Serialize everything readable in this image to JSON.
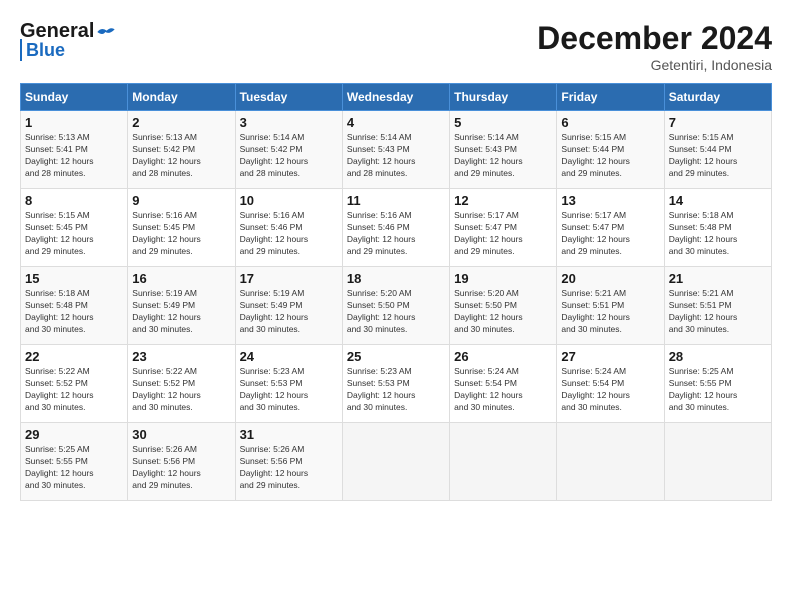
{
  "header": {
    "logo_general": "General",
    "logo_blue": "Blue",
    "month_title": "December 2024",
    "subtitle": "Getentiri, Indonesia"
  },
  "days_of_week": [
    "Sunday",
    "Monday",
    "Tuesday",
    "Wednesday",
    "Thursday",
    "Friday",
    "Saturday"
  ],
  "weeks": [
    [
      {
        "day": "1",
        "info": "Sunrise: 5:13 AM\nSunset: 5:41 PM\nDaylight: 12 hours\nand 28 minutes."
      },
      {
        "day": "2",
        "info": "Sunrise: 5:13 AM\nSunset: 5:42 PM\nDaylight: 12 hours\nand 28 minutes."
      },
      {
        "day": "3",
        "info": "Sunrise: 5:14 AM\nSunset: 5:42 PM\nDaylight: 12 hours\nand 28 minutes."
      },
      {
        "day": "4",
        "info": "Sunrise: 5:14 AM\nSunset: 5:43 PM\nDaylight: 12 hours\nand 28 minutes."
      },
      {
        "day": "5",
        "info": "Sunrise: 5:14 AM\nSunset: 5:43 PM\nDaylight: 12 hours\nand 29 minutes."
      },
      {
        "day": "6",
        "info": "Sunrise: 5:15 AM\nSunset: 5:44 PM\nDaylight: 12 hours\nand 29 minutes."
      },
      {
        "day": "7",
        "info": "Sunrise: 5:15 AM\nSunset: 5:44 PM\nDaylight: 12 hours\nand 29 minutes."
      }
    ],
    [
      {
        "day": "8",
        "info": "Sunrise: 5:15 AM\nSunset: 5:45 PM\nDaylight: 12 hours\nand 29 minutes."
      },
      {
        "day": "9",
        "info": "Sunrise: 5:16 AM\nSunset: 5:45 PM\nDaylight: 12 hours\nand 29 minutes."
      },
      {
        "day": "10",
        "info": "Sunrise: 5:16 AM\nSunset: 5:46 PM\nDaylight: 12 hours\nand 29 minutes."
      },
      {
        "day": "11",
        "info": "Sunrise: 5:16 AM\nSunset: 5:46 PM\nDaylight: 12 hours\nand 29 minutes."
      },
      {
        "day": "12",
        "info": "Sunrise: 5:17 AM\nSunset: 5:47 PM\nDaylight: 12 hours\nand 29 minutes."
      },
      {
        "day": "13",
        "info": "Sunrise: 5:17 AM\nSunset: 5:47 PM\nDaylight: 12 hours\nand 29 minutes."
      },
      {
        "day": "14",
        "info": "Sunrise: 5:18 AM\nSunset: 5:48 PM\nDaylight: 12 hours\nand 30 minutes."
      }
    ],
    [
      {
        "day": "15",
        "info": "Sunrise: 5:18 AM\nSunset: 5:48 PM\nDaylight: 12 hours\nand 30 minutes."
      },
      {
        "day": "16",
        "info": "Sunrise: 5:19 AM\nSunset: 5:49 PM\nDaylight: 12 hours\nand 30 minutes."
      },
      {
        "day": "17",
        "info": "Sunrise: 5:19 AM\nSunset: 5:49 PM\nDaylight: 12 hours\nand 30 minutes."
      },
      {
        "day": "18",
        "info": "Sunrise: 5:20 AM\nSunset: 5:50 PM\nDaylight: 12 hours\nand 30 minutes."
      },
      {
        "day": "19",
        "info": "Sunrise: 5:20 AM\nSunset: 5:50 PM\nDaylight: 12 hours\nand 30 minutes."
      },
      {
        "day": "20",
        "info": "Sunrise: 5:21 AM\nSunset: 5:51 PM\nDaylight: 12 hours\nand 30 minutes."
      },
      {
        "day": "21",
        "info": "Sunrise: 5:21 AM\nSunset: 5:51 PM\nDaylight: 12 hours\nand 30 minutes."
      }
    ],
    [
      {
        "day": "22",
        "info": "Sunrise: 5:22 AM\nSunset: 5:52 PM\nDaylight: 12 hours\nand 30 minutes."
      },
      {
        "day": "23",
        "info": "Sunrise: 5:22 AM\nSunset: 5:52 PM\nDaylight: 12 hours\nand 30 minutes."
      },
      {
        "day": "24",
        "info": "Sunrise: 5:23 AM\nSunset: 5:53 PM\nDaylight: 12 hours\nand 30 minutes."
      },
      {
        "day": "25",
        "info": "Sunrise: 5:23 AM\nSunset: 5:53 PM\nDaylight: 12 hours\nand 30 minutes."
      },
      {
        "day": "26",
        "info": "Sunrise: 5:24 AM\nSunset: 5:54 PM\nDaylight: 12 hours\nand 30 minutes."
      },
      {
        "day": "27",
        "info": "Sunrise: 5:24 AM\nSunset: 5:54 PM\nDaylight: 12 hours\nand 30 minutes."
      },
      {
        "day": "28",
        "info": "Sunrise: 5:25 AM\nSunset: 5:55 PM\nDaylight: 12 hours\nand 30 minutes."
      }
    ],
    [
      {
        "day": "29",
        "info": "Sunrise: 5:25 AM\nSunset: 5:55 PM\nDaylight: 12 hours\nand 30 minutes."
      },
      {
        "day": "30",
        "info": "Sunrise: 5:26 AM\nSunset: 5:56 PM\nDaylight: 12 hours\nand 29 minutes."
      },
      {
        "day": "31",
        "info": "Sunrise: 5:26 AM\nSunset: 5:56 PM\nDaylight: 12 hours\nand 29 minutes."
      },
      {
        "day": "",
        "info": ""
      },
      {
        "day": "",
        "info": ""
      },
      {
        "day": "",
        "info": ""
      },
      {
        "day": "",
        "info": ""
      }
    ]
  ]
}
